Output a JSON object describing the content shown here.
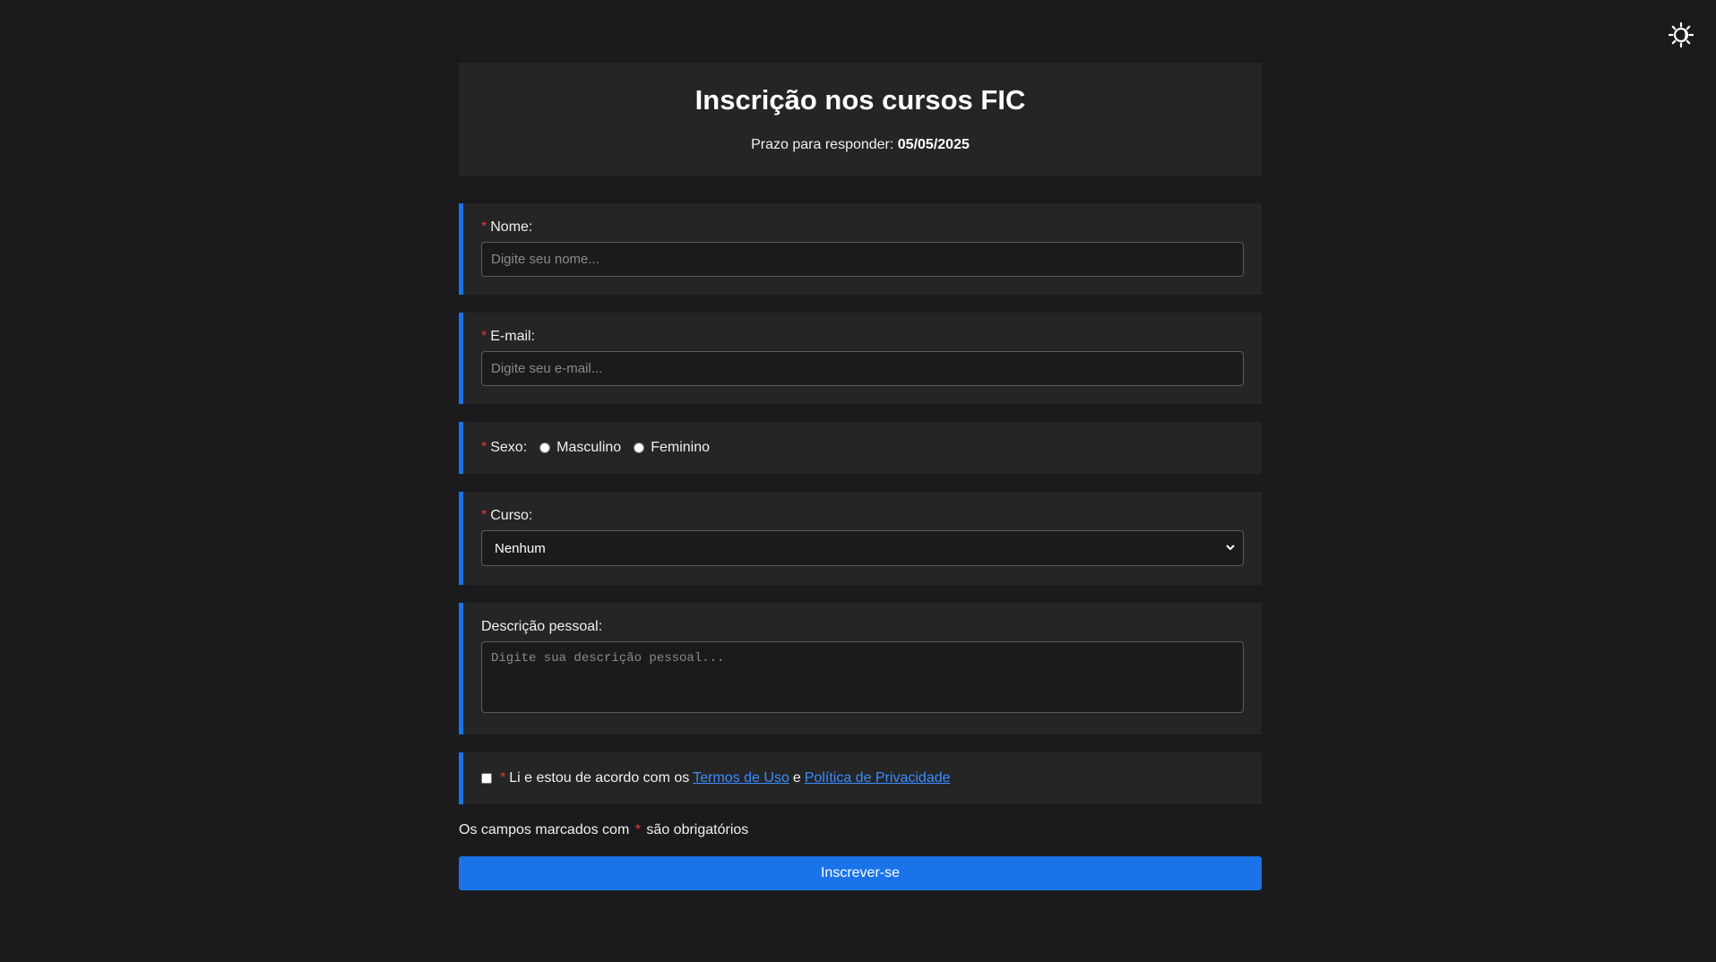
{
  "header": {
    "title": "Inscrição nos cursos FIC",
    "deadline_label": "Prazo para responder:",
    "deadline_value": "05/05/2025"
  },
  "theme_toggle": {
    "icon": "sun-moon-icon"
  },
  "colors": {
    "accent": "#1a73e8",
    "required": "#e53935",
    "background": "#1b1b1d",
    "card": "#252526",
    "link": "#3b8cff"
  },
  "form": {
    "required_mark": "*",
    "nome": {
      "label": "Nome:",
      "placeholder": "Digite seu nome...",
      "value": ""
    },
    "email": {
      "label": "E-mail:",
      "placeholder": "Digite seu e-mail...",
      "value": ""
    },
    "sexo": {
      "label": "Sexo:",
      "options": [
        {
          "label": "Masculino",
          "checked": false
        },
        {
          "label": "Feminino",
          "checked": false
        }
      ]
    },
    "curso": {
      "label": "Curso:",
      "selected": "Nenhum"
    },
    "descricao": {
      "label": "Descrição pessoal:",
      "placeholder": "Digite sua descrição pessoal...",
      "value": ""
    },
    "terms": {
      "checked": false,
      "text_before": "Li e estou de acordo com os",
      "terms_link": "Termos de Uso",
      "conjunction": "e",
      "privacy_link": "Política de Privacidade"
    },
    "note_before": "Os campos marcados com",
    "note_after": "são obrigatórios",
    "submit_label": "Inscrever-se"
  }
}
